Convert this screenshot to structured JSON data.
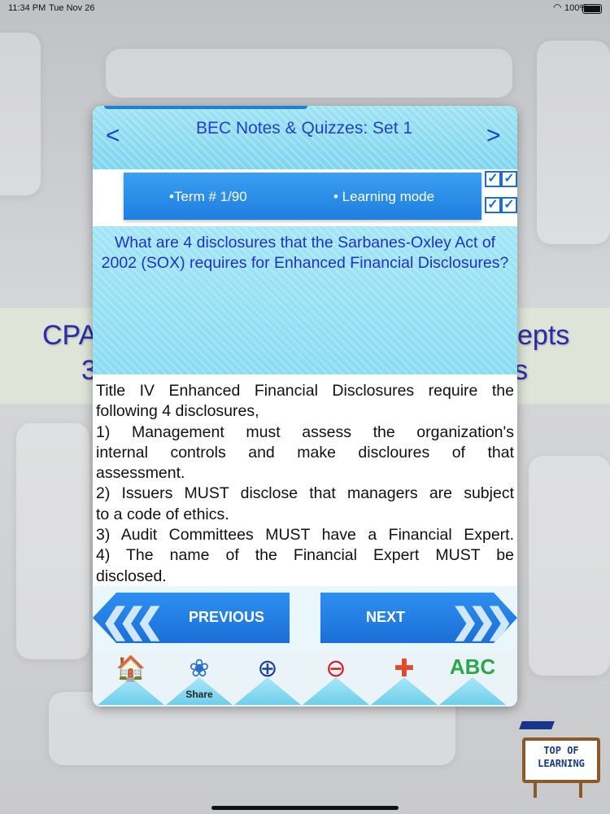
{
  "status": {
    "time": "11:34 PM",
    "date": "Tue Nov 26",
    "battery": "100%"
  },
  "background": {
    "text_left": "CPA",
    "text_right": "epts",
    "text_left2": "3",
    "text_right2": "s"
  },
  "header": {
    "prev_arrow": "<",
    "next_arrow": ">",
    "title": "BEC Notes &  Quizzes: Set 1"
  },
  "termbar": {
    "term": "•Term #  1/90",
    "mode": "• Learning mode"
  },
  "question": "What are 4 disclosures that the Sarbanes-Oxley Act of 2002 (SOX) requires for Enhanced Financial Disclosures?",
  "answer": {
    "lines": [
      "Title IV Enhanced Financial Disclosures require the",
      "following 4 disclosures,",
      "1) Management must assess the organization's",
      "internal controls and make discloures of that",
      "assessment.",
      "2) Issuers MUST disclose that managers are subject",
      "to a code of ethics.",
      "3) Audit Committees MUST have a Financial Expert.",
      "4) The name of the Financial Expert MUST be",
      "disclosed."
    ]
  },
  "buttons": {
    "previous": "PREVIOUS",
    "next": "NEXT"
  },
  "toolbar": {
    "share_label": "Share"
  },
  "logo": {
    "line1": "TOP OF",
    "line2": "LEARNING"
  },
  "colors": {
    "accent": "#1e7fe0",
    "title": "#2341c8",
    "panel_bg": "#8bdcf2"
  }
}
